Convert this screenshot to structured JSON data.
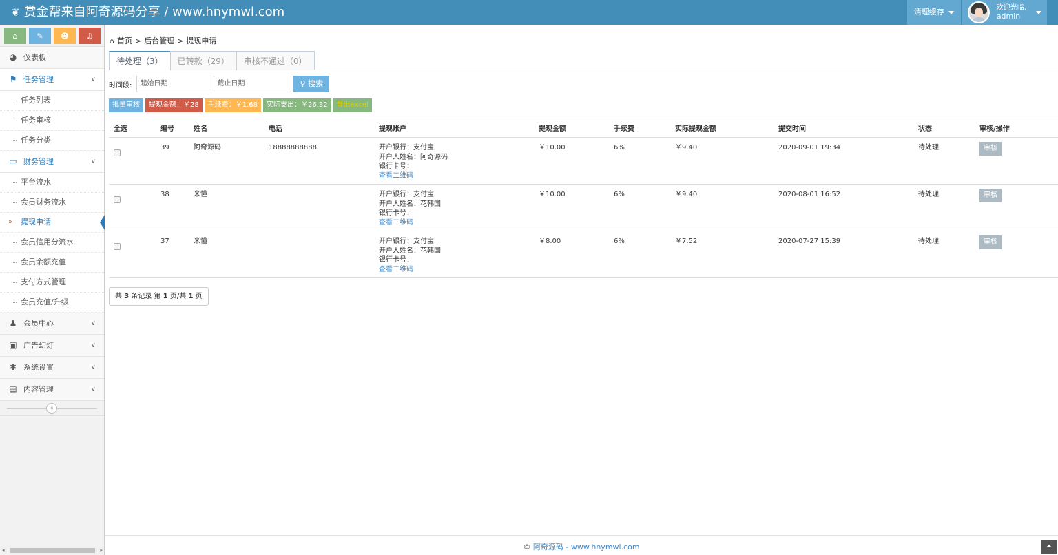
{
  "header": {
    "brand": "赏金帮来自阿奇源码分享 / www.hnymwl.com",
    "clear_cache": "清理缓存",
    "welcome": "欢迎光临,",
    "username": "admin"
  },
  "sidebar": {
    "menu": [
      {
        "label": "仪表板"
      },
      {
        "label": "任务管理",
        "subs": [
          "任务列表",
          "任务审核",
          "任务分类"
        ]
      },
      {
        "label": "财务管理",
        "subs": [
          "平台流水",
          "会员财务流水",
          "提现申请",
          "会员信用分流水",
          "会员余额充值",
          "支付方式管理",
          "会员充值/升级"
        ]
      },
      {
        "label": "会员中心"
      },
      {
        "label": "广告幻灯"
      },
      {
        "label": "系统设置"
      },
      {
        "label": "内容管理"
      }
    ]
  },
  "breadcrumb": {
    "home": "首页",
    "sep": ">",
    "section": "后台管理",
    "page": "提现申请"
  },
  "tabs": [
    {
      "label": "待处理（3）"
    },
    {
      "label": "已转款（29）"
    },
    {
      "label": "审核不通过（0）"
    }
  ],
  "filter": {
    "label": "时间段:",
    "start_placeholder": "起始日期",
    "end_placeholder": "截止日期",
    "search": "搜索"
  },
  "actions": {
    "batch": "批量审核",
    "amount": "提现金额：￥28",
    "fee": "手续费：￥1.68",
    "actual": "实际支出：￥26.32",
    "export": "导出excel"
  },
  "table": {
    "headers": [
      "全选",
      "编号",
      "姓名",
      "电话",
      "提现账户",
      "提现金额",
      "手续费",
      "实际提现金额",
      "提交时间",
      "状态",
      "审核/操作"
    ],
    "rows": [
      {
        "id": "39",
        "name": "阿奇源码",
        "phone": "18888888888",
        "bank": "开户银行：支付宝",
        "holder": "开户人姓名：阿奇源码",
        "card": "银行卡号：",
        "qr": "查看二维码",
        "amount": "￥10.00",
        "fee": "6%",
        "actual": "￥9.40",
        "time": "2020-09-01 19:34",
        "status": "待处理",
        "op": "审核"
      },
      {
        "id": "38",
        "name": "米懂",
        "phone": "",
        "bank": "开户银行：支付宝",
        "holder": "开户人姓名：花韩国",
        "card": "银行卡号：",
        "qr": "查看二维码",
        "amount": "￥10.00",
        "fee": "6%",
        "actual": "￥9.40",
        "time": "2020-08-01 16:52",
        "status": "待处理",
        "op": "审核"
      },
      {
        "id": "37",
        "name": "米懂",
        "phone": "",
        "bank": "开户银行：支付宝",
        "holder": "开户人姓名：花韩国",
        "card": "银行卡号：",
        "qr": "查看二维码",
        "amount": "￥8.00",
        "fee": "6%",
        "actual": "￥7.52",
        "time": "2020-07-27 15:39",
        "status": "待处理",
        "op": "审核"
      }
    ]
  },
  "pager": {
    "p1": "共",
    "total": "3",
    "p2": "条记录 第",
    "page": "1",
    "p3": "页/共",
    "pages": "1",
    "p4": "页"
  },
  "footer": {
    "copy": "©",
    "link": "阿奇源码 - www.hnymwl.com"
  }
}
